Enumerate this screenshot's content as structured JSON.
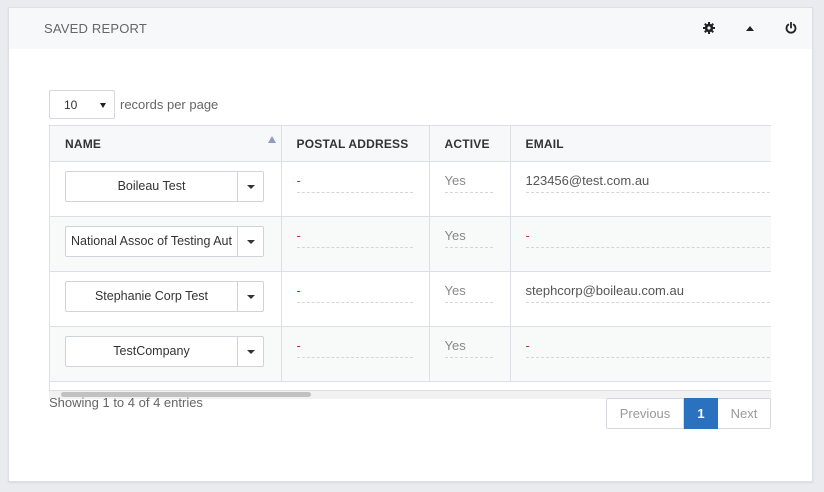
{
  "panel": {
    "title": "SAVED REPORT",
    "icons": [
      "gear-icon",
      "caret-up-icon",
      "power-icon"
    ]
  },
  "length": {
    "value": "10",
    "label": "records per page"
  },
  "table": {
    "columns": [
      "NAME",
      "POSTAL ADDRESS",
      "ACTIVE",
      "EMAIL"
    ],
    "rows": [
      {
        "name": "Boileau Test",
        "postal": "-",
        "active": "Yes",
        "email": "123456@test.com.au"
      },
      {
        "name": "National Assoc of Testing Aut",
        "postal": "-",
        "active": "Yes",
        "email": "-"
      },
      {
        "name": "Stephanie Corp Test",
        "postal": "-",
        "active": "Yes",
        "email": "stephcorp@boileau.com.au"
      },
      {
        "name": "TestCompany",
        "postal": "-",
        "active": "Yes",
        "email": "-"
      }
    ]
  },
  "info": "Showing 1 to 4 of 4 entries",
  "pagination": {
    "previous": "Previous",
    "current": "1",
    "next": "Next"
  },
  "colors": {
    "accent": "#2a72c0",
    "dash": "#c9302c",
    "sort": "#8e9bc4"
  }
}
